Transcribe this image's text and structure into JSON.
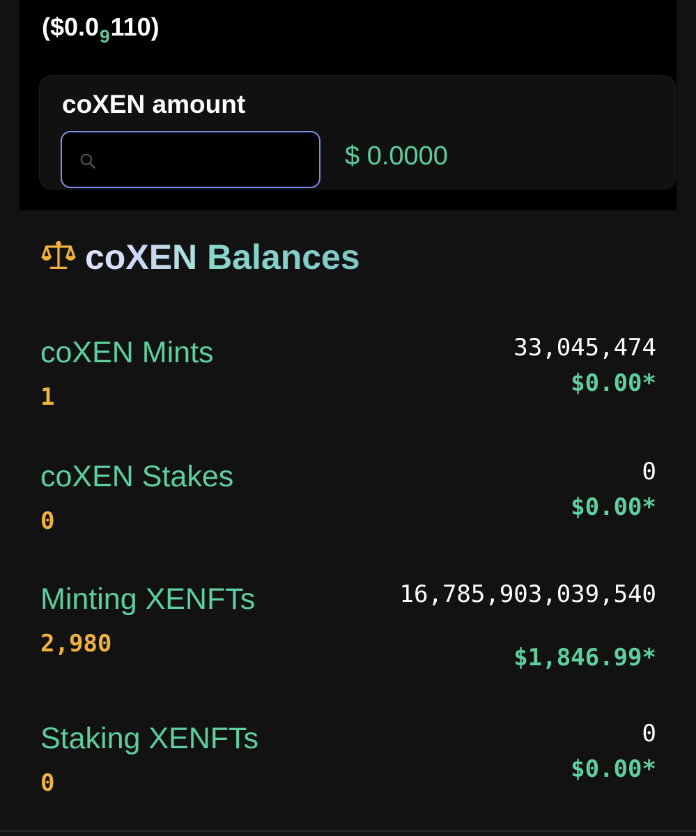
{
  "price": {
    "prefix": "($0.0",
    "zero_count": "9",
    "suffix": "110)"
  },
  "amount_card": {
    "label": "coXEN amount",
    "input_value": "",
    "input_placeholder": "",
    "usd_value": "$ 0.0000",
    "search_icon": "search-icon"
  },
  "balances": {
    "icon": "scale-icon",
    "title_part1": "coXEN",
    "title_part2": "Balances",
    "rows": [
      {
        "label": "coXEN Mints",
        "count": "1",
        "amount": "33,045,474",
        "usd": "$0.00*"
      },
      {
        "label": "coXEN Stakes",
        "count": "0",
        "amount": "0",
        "usd": "$0.00*"
      },
      {
        "label": "Minting XENFTs",
        "count": "2,980",
        "amount": "16,785,903,039,540",
        "usd": "$1,846.99*"
      },
      {
        "label": "Staking XENFTs",
        "count": "0",
        "amount": "0",
        "usd": "$0.00*"
      }
    ]
  },
  "colors": {
    "accent_green": "#5ecf9e",
    "count_orange": "#f0b23e",
    "input_border": "#7f8ee8",
    "background": "#121212",
    "panel": "#000000"
  }
}
